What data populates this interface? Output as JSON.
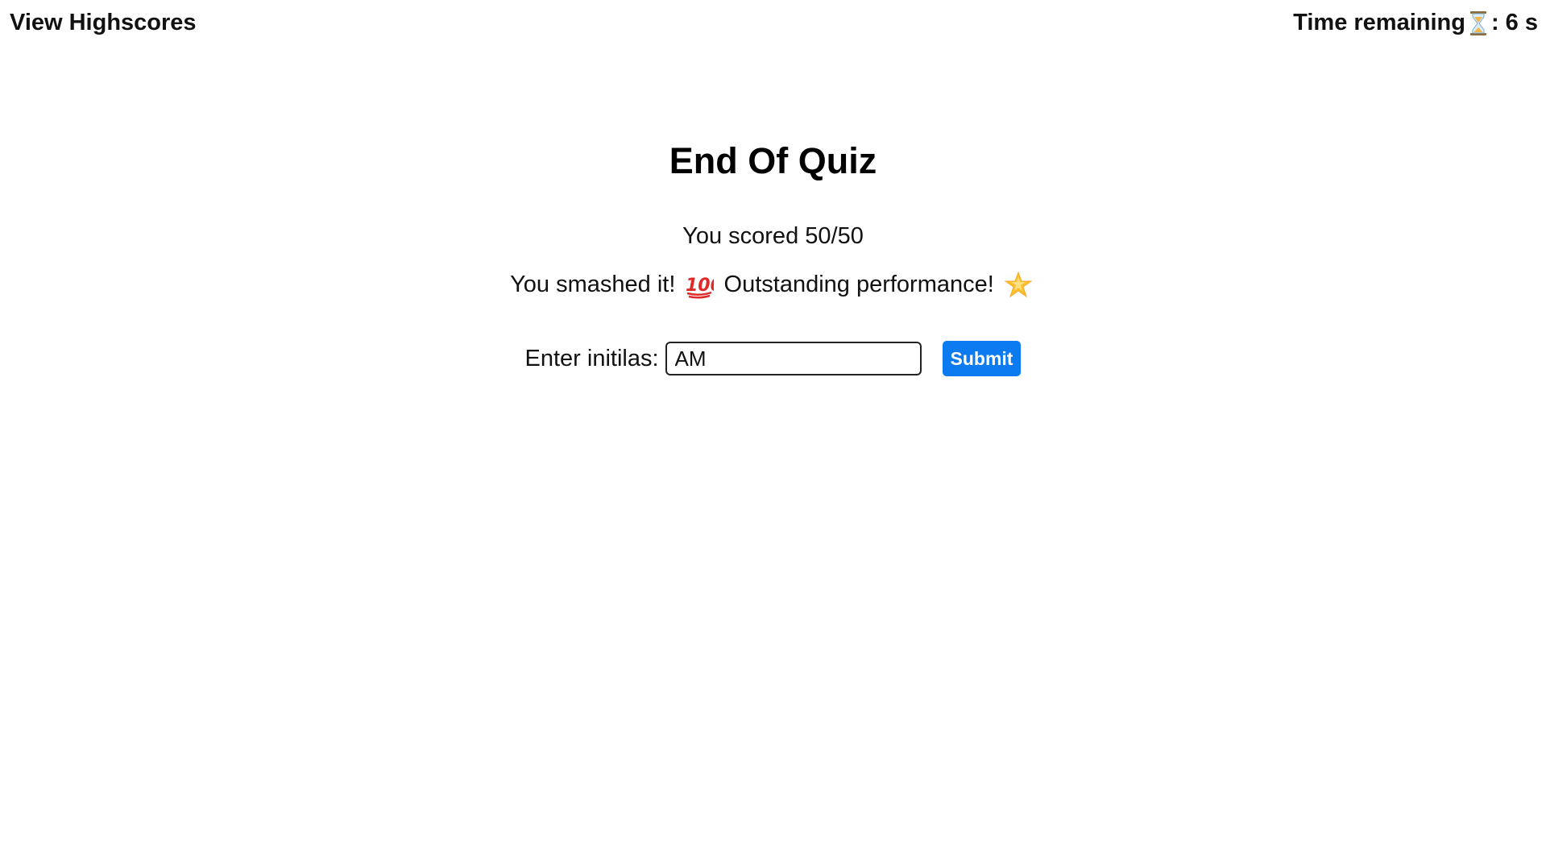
{
  "header": {
    "highscores_link": "View Highscores",
    "timer_label": "Time remaining",
    "timer_icon": "hourglass-icon",
    "timer_value": ": 6 s"
  },
  "main": {
    "title": "End Of Quiz",
    "score_text": "You scored 50/50",
    "message_part1": "You smashed it!",
    "message_icon1": "hundred-points-icon",
    "message_part2": "Outstanding performance!",
    "message_icon2": "glowing-star-icon",
    "form": {
      "label": "Enter initilas:",
      "input_value": "AM",
      "submit_label": "Submit"
    }
  },
  "colors": {
    "accent": "#0d7bf0",
    "text": "#111111",
    "background": "#ffffff"
  }
}
